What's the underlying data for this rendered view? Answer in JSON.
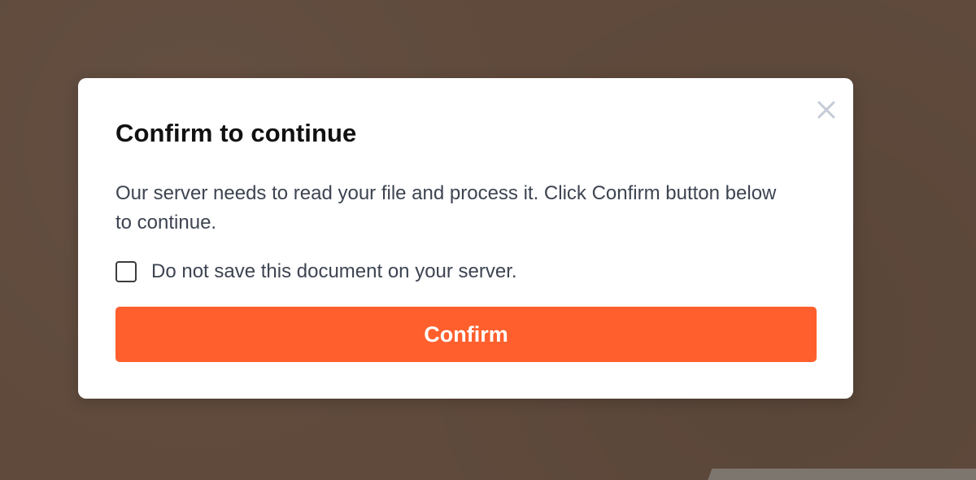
{
  "dialog": {
    "title": "Confirm to continue",
    "message": "Our server needs to read your file and process it. Click Confirm button below to continue.",
    "checkbox": {
      "label": "Do not save this document on your server.",
      "checked": false
    },
    "confirm_label": "Confirm",
    "close_icon": "close-icon"
  },
  "colors": {
    "backdrop": "#5f4a3c",
    "accent": "#ff5f2d",
    "title": "#111111",
    "body_text": "#3d4451",
    "close_icon": "#c4cbd6"
  }
}
